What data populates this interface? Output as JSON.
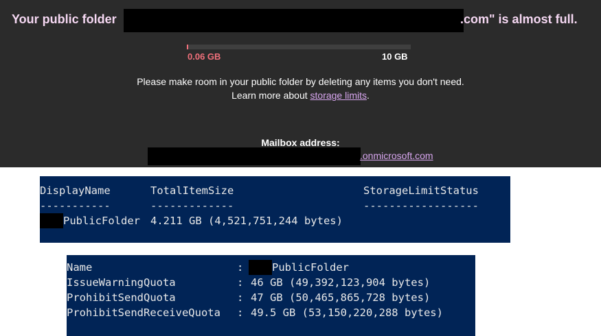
{
  "banner": {
    "title_prefix": "Your public folder",
    "title_suffix": ".com\" is almost full."
  },
  "storage": {
    "used_label": "0.06 GB",
    "total_label": "10 GB",
    "used_fraction": 0.006,
    "accent_color": "#f1707b"
  },
  "message": {
    "line1": "Please make room in your public folder by deleting any items you don't need.",
    "line2_prefix": "Learn more about ",
    "link_text": "storage limits",
    "line2_suffix": "."
  },
  "mailbox": {
    "label": "Mailbox address:",
    "domain_suffix": ".onmicrosoft.com"
  },
  "stats_table": {
    "headers": [
      "DisplayName",
      "TotalItemSize",
      "StorageLimitStatus"
    ],
    "separators": [
      "-----------",
      "-------------",
      "------------------"
    ],
    "row": {
      "display_name_suffix": "PublicFolder",
      "total_item_size": "4.211 GB (4,521,751,244 bytes)"
    }
  },
  "quota_list": {
    "items": [
      {
        "key": "Name",
        "value": "PublicFolder"
      },
      {
        "key": "IssueWarningQuota",
        "value": "46 GB (49,392,123,904 bytes)"
      },
      {
        "key": "ProhibitSendQuota",
        "value": "47 GB (50,465,865,728 bytes)"
      },
      {
        "key": "ProhibitSendReceiveQuota",
        "value": "49.5 GB (53,150,220,288 bytes)"
      }
    ]
  }
}
